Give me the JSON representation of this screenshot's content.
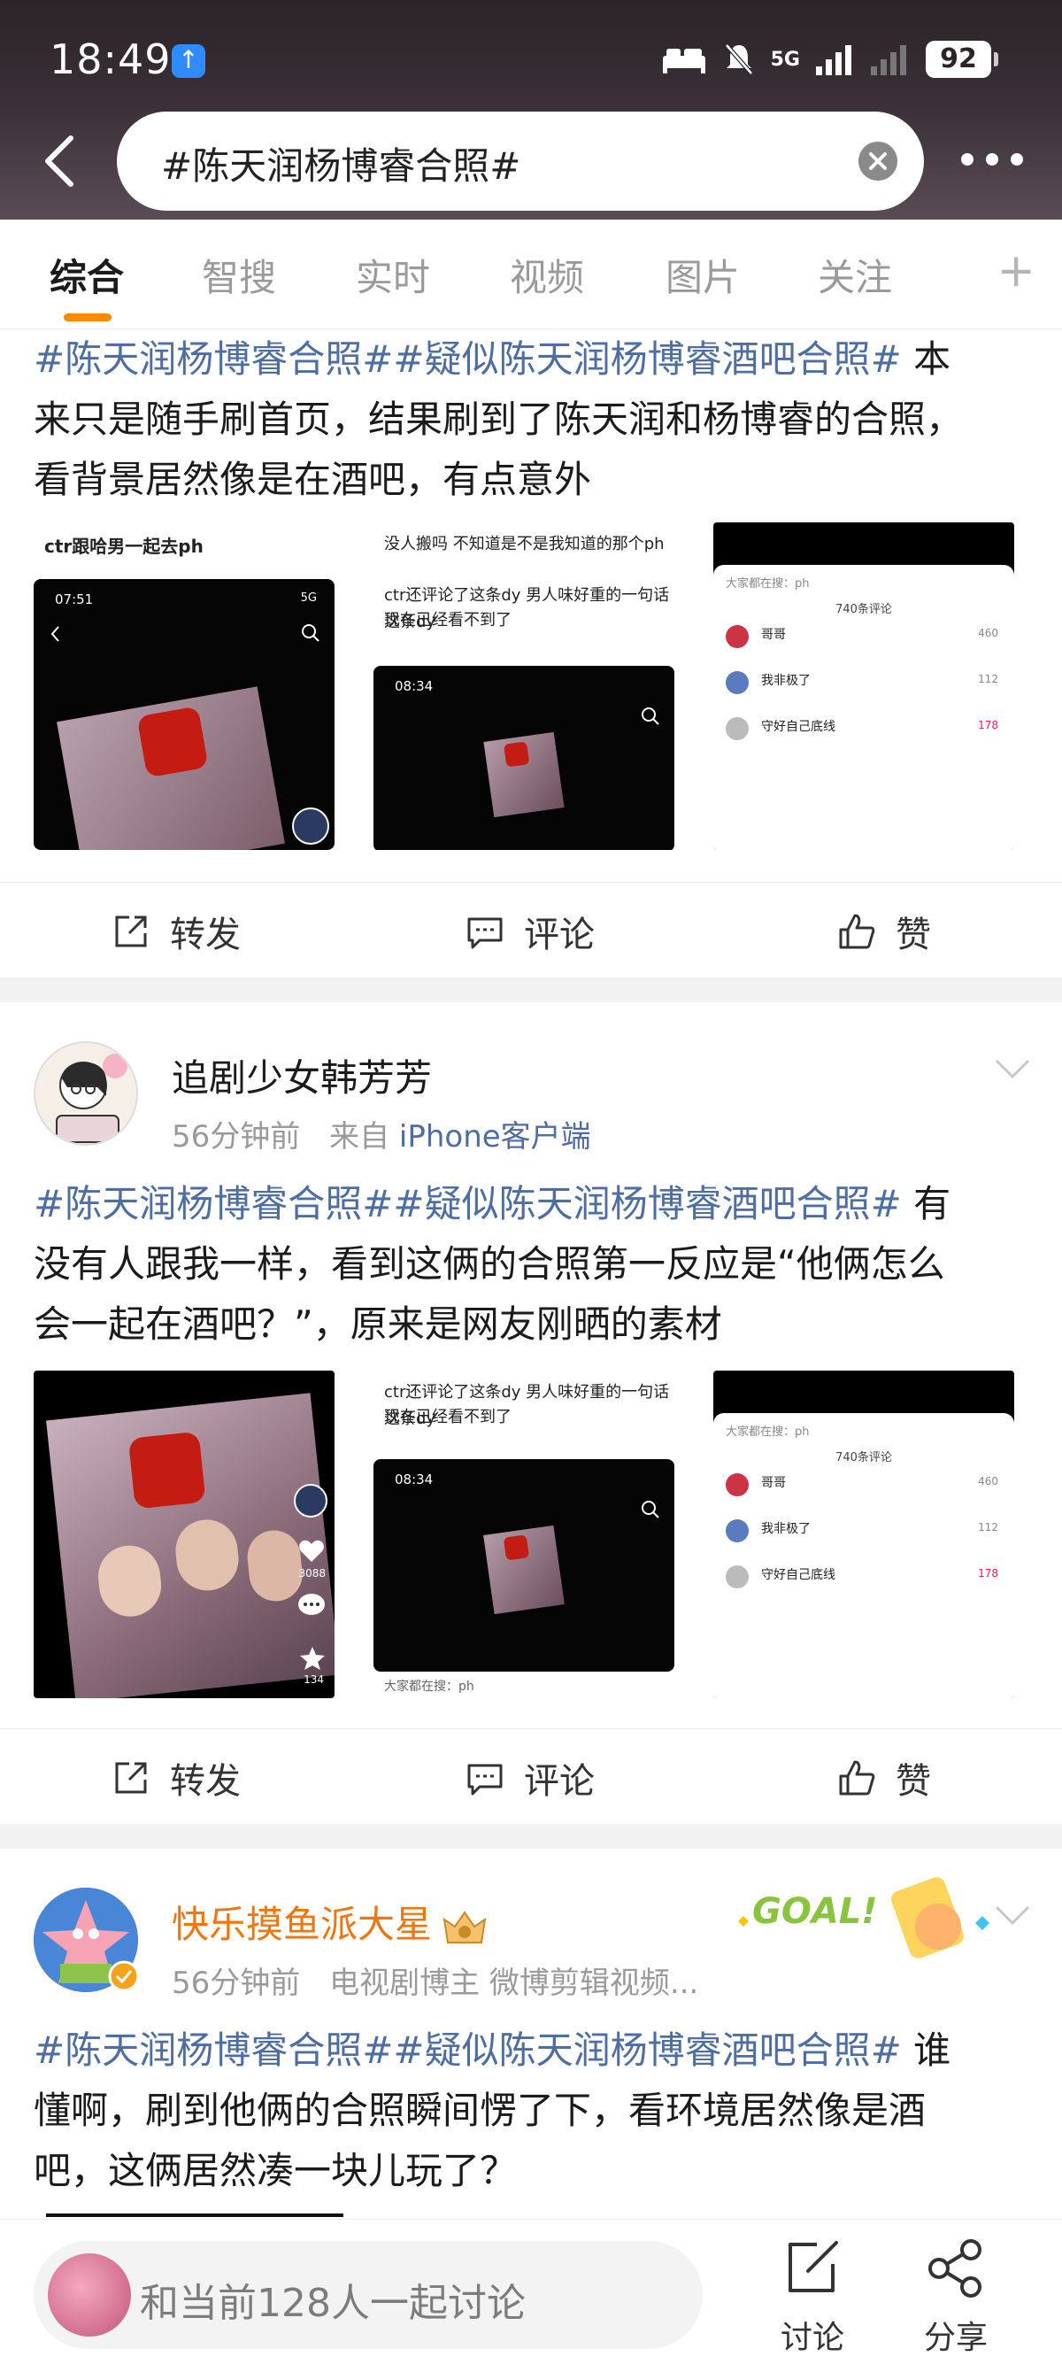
{
  "status": {
    "time": "18:49",
    "network": "5G",
    "battery": "92"
  },
  "search": {
    "query": "#陈天润杨博睿合照#"
  },
  "tabs": [
    {
      "label": "综合",
      "active": true
    },
    {
      "label": "智搜"
    },
    {
      "label": "实时"
    },
    {
      "label": "视频"
    },
    {
      "label": "图片"
    },
    {
      "label": "关注"
    }
  ],
  "actions": {
    "repost": "转发",
    "comment": "评论",
    "like": "赞"
  },
  "posts": [
    {
      "hashtags": "#陈天润杨博睿合照##疑似陈天润杨博睿酒吧合照#",
      "text_line1_rest": " 本",
      "text_line2": "来只是随手刷首页，结果刷到了陈天润和杨博睿的合照，",
      "text_line3": "看背景居然像是在酒吧，有点意外",
      "images": {
        "img1_caption": "ctr跟哈男一起去ph",
        "img1_time": "07:51",
        "img2_caption_a": "没人搬吗 不知道是不是我知道的那个ph",
        "img2_caption_b": "ctr还评论了这条dy 男人味好重的一句话 这条dy",
        "img2_caption_c": "现在已经看不到了",
        "img2_time": "08:34",
        "img3_head": "大家都在搜：ph",
        "img3_count": "740条评论",
        "img3_c1": "哥哥",
        "img3_c2": "我非极了",
        "img3_c3": "守好自己底线",
        "img3_like1": "460",
        "img3_like2": "112",
        "img3_like3": "178"
      }
    },
    {
      "user": "追剧少女韩芳芳",
      "time": "56分钟前",
      "source_prefix": "来自",
      "source": "iPhone客户端",
      "hashtags": "#陈天润杨博睿合照##疑似陈天润杨博睿酒吧合照#",
      "text_line1_rest": " 有",
      "text_line2": "没有人跟我一样，看到这俩的合照第一反应是“他俩怎么",
      "text_line3": "会一起在酒吧？”，原来是网友刚晒的素材",
      "images": {
        "img1_likes": "3088",
        "img1_stars": "134",
        "img2_caption_b": "ctr还评论了这条dy 男人味好重的一句话 这条dy",
        "img2_caption_c": "现在已经看不到了",
        "img2_time": "08:34",
        "img2_foot": "大家都在搜：ph",
        "img3_head": "大家都在搜：ph",
        "img3_count": "740条评论",
        "img3_c1": "哥哥",
        "img3_c2": "我非极了",
        "img3_c3": "守好自己底线",
        "img3_like1": "460",
        "img3_like2": "112",
        "img3_like3": "178"
      }
    },
    {
      "user": "快乐摸鱼派大星",
      "time": "56分钟前",
      "meta": "电视剧博主 微博剪辑视频...",
      "goal_badge": "GOAL!",
      "hashtags": "#陈天润杨博睿合照##疑似陈天润杨博睿酒吧合照#",
      "text_line1_rest": " 谁",
      "text_line2": "懂啊，刷到他俩的合照瞬间愣了下，看环境居然像是酒",
      "text_line3": "吧，这俩居然凑一块儿玩了？"
    }
  ],
  "bottom": {
    "discuss_placeholder": "和当前128人一起讨论",
    "discuss_btn": "讨论",
    "share_btn": "分享"
  },
  "colors": {
    "hashtag": "#4d6da3",
    "accent": "#ff8a00",
    "orange_name": "#f0750f"
  }
}
